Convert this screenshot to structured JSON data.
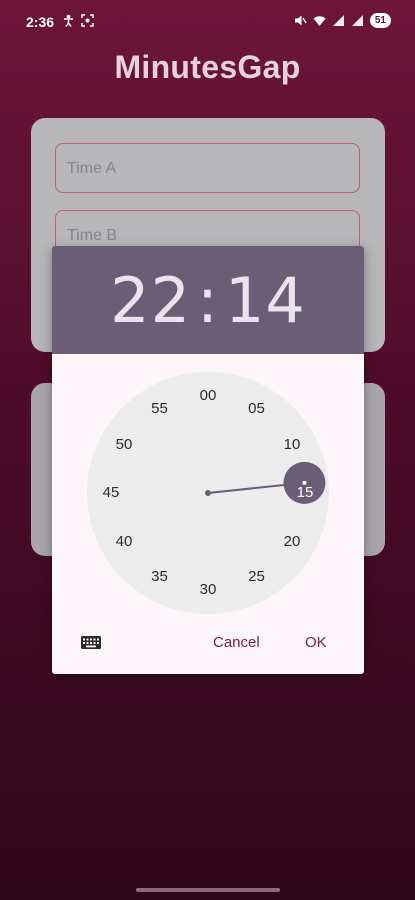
{
  "status_bar": {
    "time": "2:36",
    "left_icons": [
      "accessibility-icon",
      "screenshot-icon"
    ],
    "right_icons": [
      "mute-icon",
      "wifi-icon",
      "signal-icon",
      "signal-icon"
    ],
    "battery": "51"
  },
  "app": {
    "title": "MinutesGap"
  },
  "form": {
    "time_a_placeholder": "Time A",
    "time_b_placeholder": "Time B"
  },
  "time_picker": {
    "hour": "22",
    "separator": ":",
    "minute": "14",
    "selected_minute": 15,
    "minutes": [
      "00",
      "05",
      "10",
      "15",
      "20",
      "25",
      "30",
      "35",
      "40",
      "45",
      "50",
      "55"
    ],
    "cancel_label": "Cancel",
    "ok_label": "OK",
    "keyboard_icon": "keyboard-icon"
  },
  "colors": {
    "background_top": "#6e1538",
    "background_bottom": "#2e0718",
    "header": "#6a5d76",
    "accent": "#7a1a46",
    "selector": "#6a5d76"
  }
}
